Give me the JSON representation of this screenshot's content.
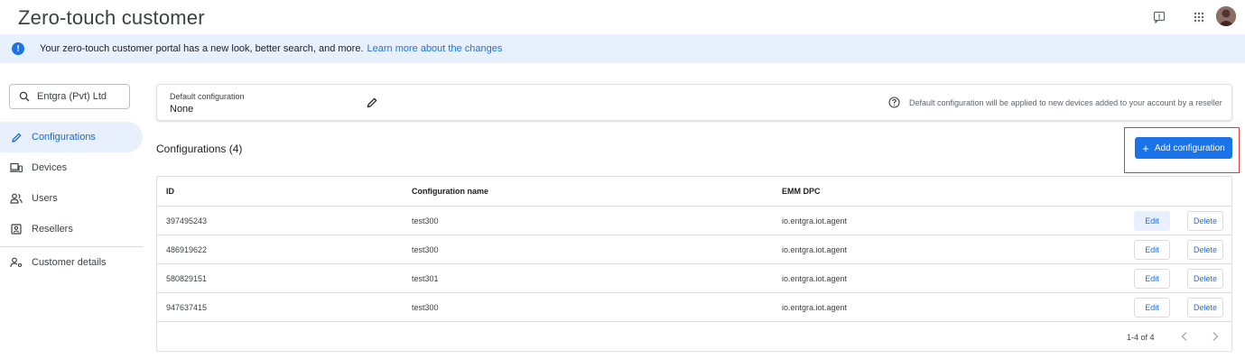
{
  "app": {
    "title": "Zero-touch customer"
  },
  "topbar": {
    "feedback_icon": "feedback-icon",
    "apps_icon": "apps-grid-icon",
    "avatar": "user-avatar"
  },
  "banner": {
    "text": "Your zero-touch customer portal has a new look, better search, and more.",
    "link": "Learn more about the changes",
    "icon": "info-icon"
  },
  "search": {
    "value": "Entgra (Pvt) Ltd",
    "icon": "search-icon"
  },
  "sidebar": {
    "items": [
      {
        "label": "Configurations",
        "icon": "pencil-icon",
        "active": true
      },
      {
        "label": "Devices",
        "icon": "devices-icon",
        "active": false
      },
      {
        "label": "Users",
        "icon": "users-icon",
        "active": false
      },
      {
        "label": "Resellers",
        "icon": "reseller-icon",
        "active": false
      },
      {
        "label": "Customer details",
        "icon": "customer-details-icon",
        "active": false
      }
    ]
  },
  "default_config": {
    "label": "Default configuration",
    "value": "None",
    "note": "Default configuration will be applied to new devices added to your account by a reseller"
  },
  "configurations": {
    "title": "Configurations (4)",
    "add_button": "Add configuration",
    "columns": [
      "ID",
      "Configuration name",
      "EMM DPC"
    ],
    "rows": [
      {
        "id": "397495243",
        "name": "test300",
        "emm": "io.entgra.iot.agent"
      },
      {
        "id": "486919622",
        "name": "test300",
        "emm": "io.entgra.iot.agent"
      },
      {
        "id": "580829151",
        "name": "test301",
        "emm": "io.entgra.iot.agent"
      },
      {
        "id": "947637415",
        "name": "test300",
        "emm": "io.entgra.iot.agent"
      }
    ],
    "edit_label": "Edit",
    "delete_label": "Delete",
    "pagination": "1-4 of 4"
  },
  "colors": {
    "accent": "#1a73e8",
    "banner_bg": "#e8f0fe",
    "highlight": "#e53935"
  }
}
